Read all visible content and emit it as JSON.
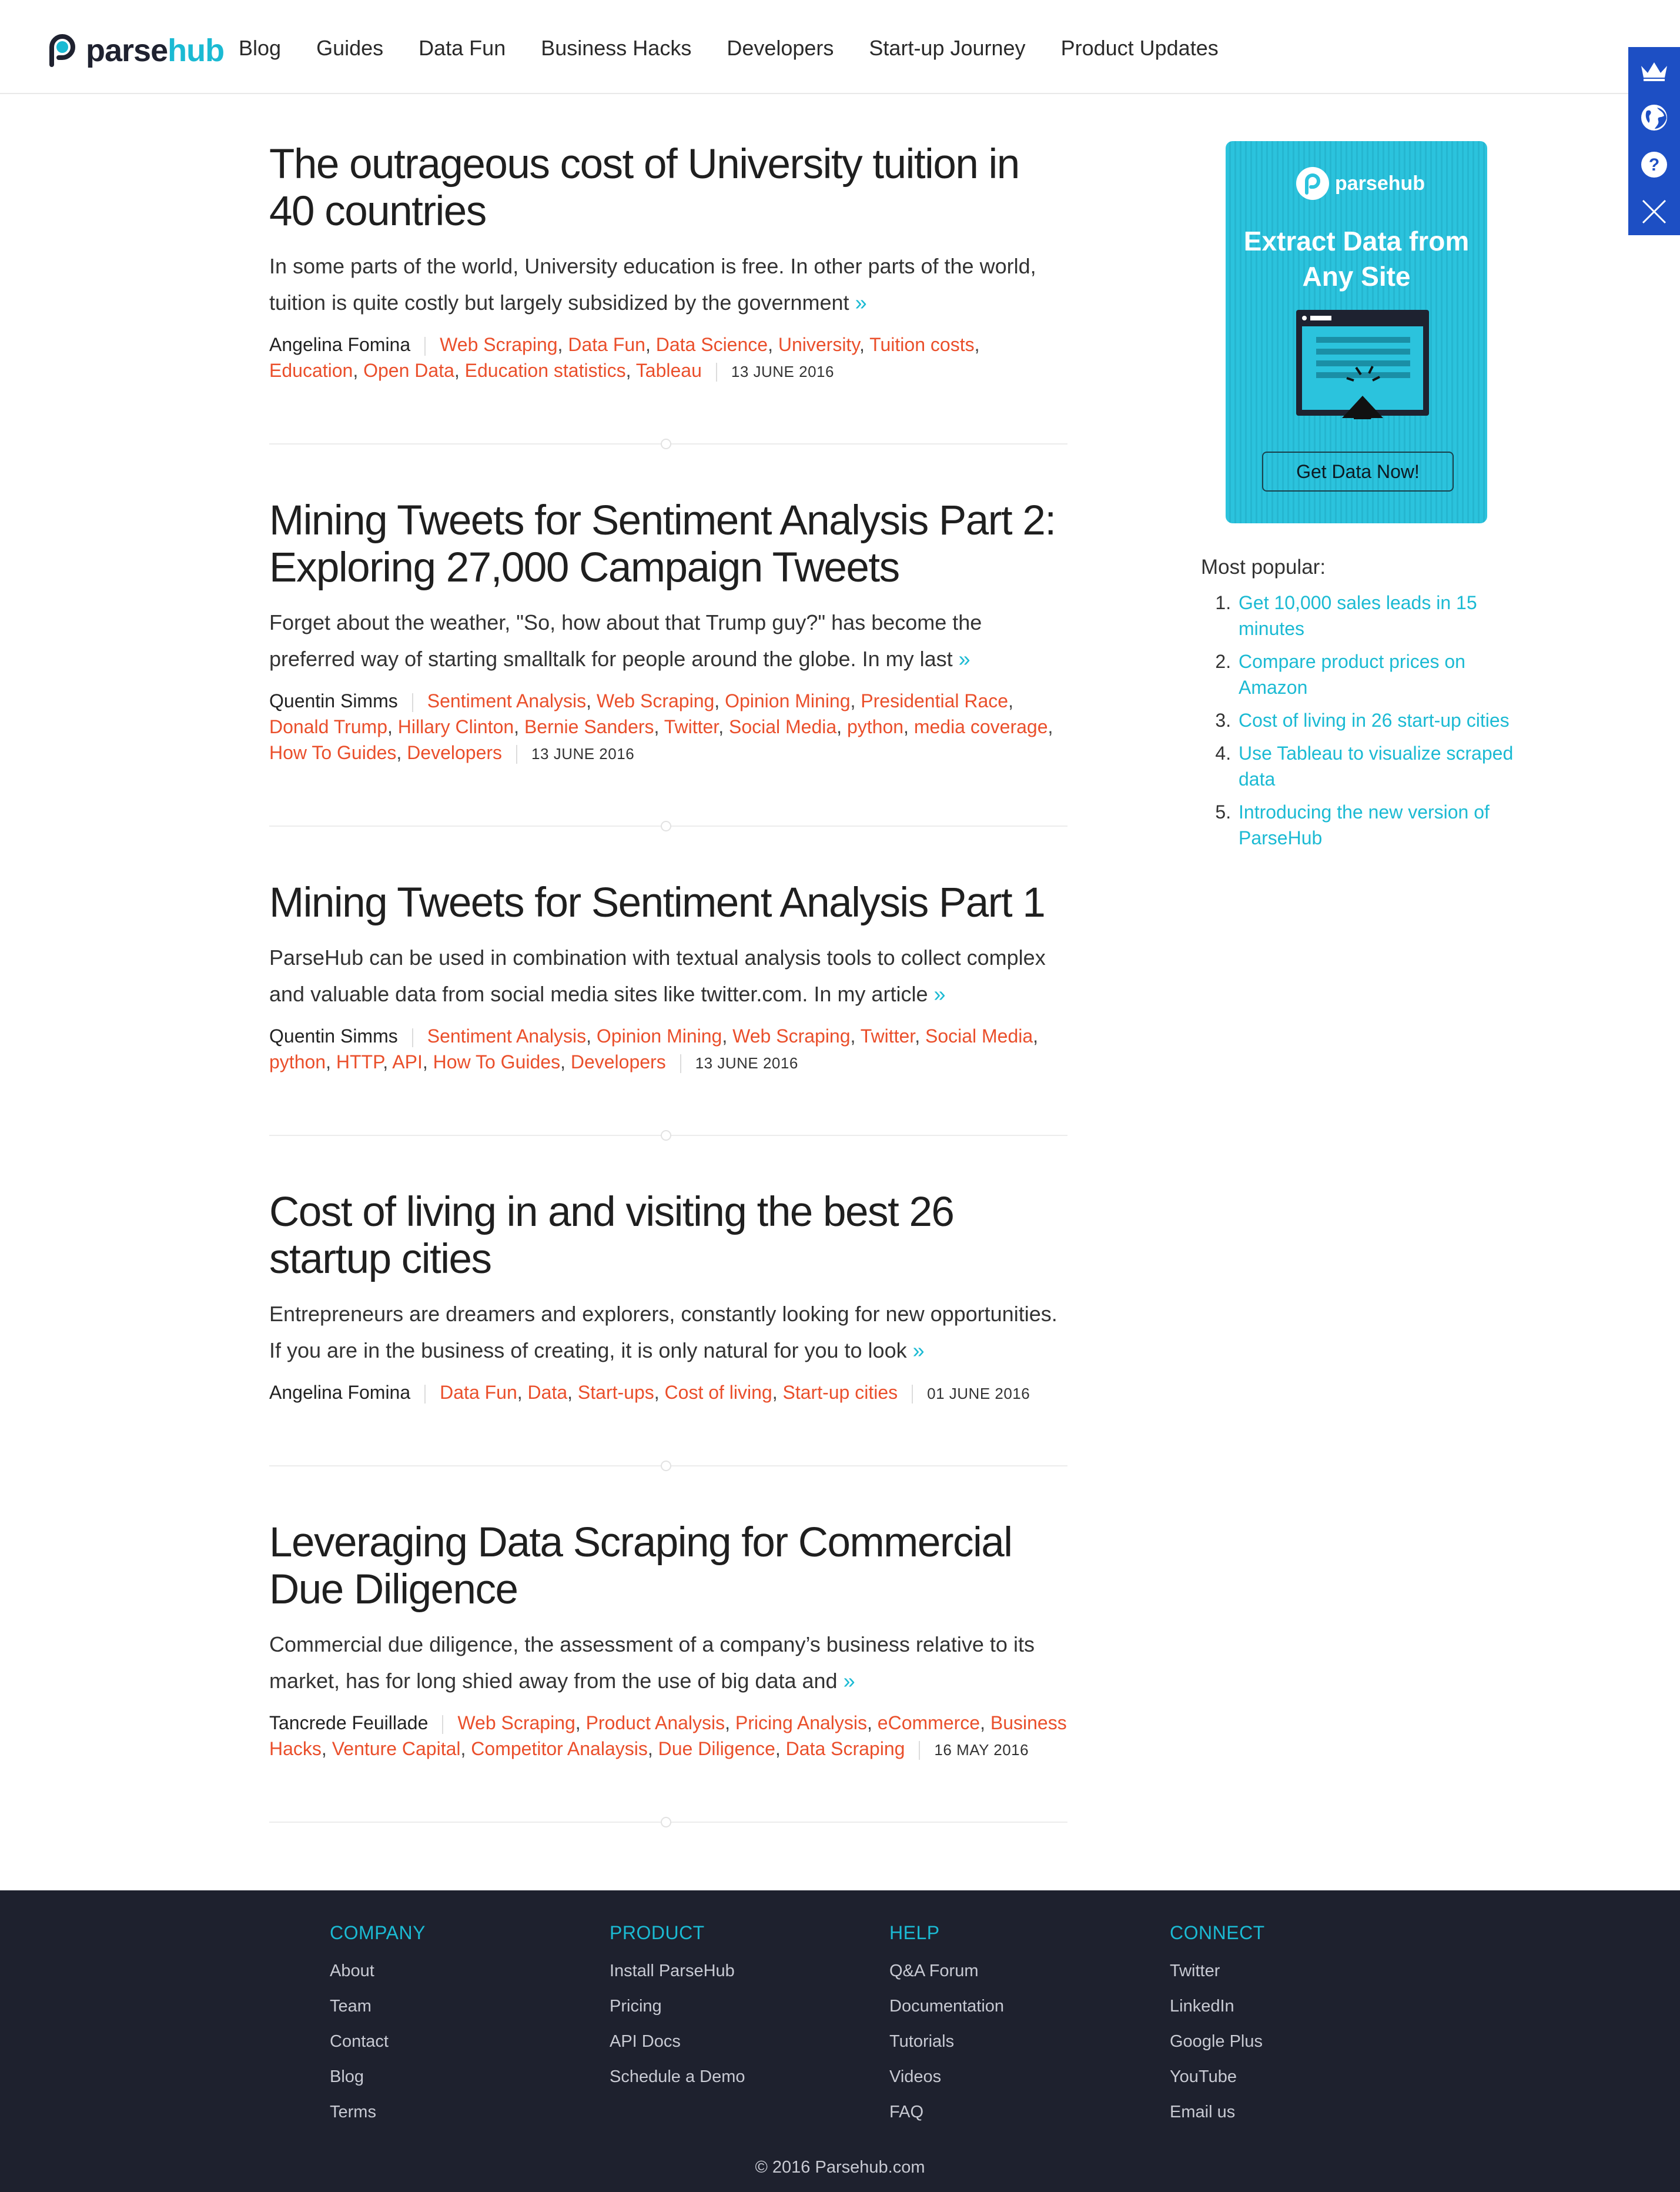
{
  "brand": {
    "name_part1": "parse",
    "name_part2": "hub",
    "accent": "#1bbad3",
    "tag_color": "#ea4f2b"
  },
  "nav": [
    "Blog",
    "Guides",
    "Data Fun",
    "Business Hacks",
    "Developers",
    "Start-up Journey",
    "Product Updates"
  ],
  "side_widget": {
    "icons": [
      "crown-icon",
      "globe-icon",
      "help-icon",
      "close-icon"
    ],
    "color": "#1d4fc4"
  },
  "articles": [
    {
      "title": "The outrageous cost of University tuition in 40 countries",
      "excerpt": "In some parts of the world, University education is free. In other parts of the world, tuition is quite costly but largely subsidized by the government",
      "more": "»",
      "author": "Angelina Fomina",
      "tags": [
        "Web Scraping",
        "Data Fun",
        "Data Science",
        "University",
        "Tuition costs",
        "Education",
        "Open Data",
        "Education statistics",
        "Tableau"
      ],
      "date": "13 JUNE 2016"
    },
    {
      "title": "Mining Tweets for Sentiment Analysis Part 2: Exploring 27,000 Campaign Tweets",
      "excerpt": "Forget about the weather, \"So, how about that Trump guy?\" has become the preferred way of starting smalltalk for people around the globe. In my last",
      "more": "»",
      "author": "Quentin Simms",
      "tags": [
        "Sentiment Analysis",
        "Web Scraping",
        "Opinion Mining",
        "Presidential Race",
        "Donald Trump",
        "Hillary Clinton",
        "Bernie Sanders",
        "Twitter",
        "Social Media",
        "python",
        "media coverage",
        "How To Guides",
        "Developers"
      ],
      "date": "13 JUNE 2016"
    },
    {
      "title": "Mining Tweets for Sentiment Analysis Part 1",
      "excerpt": "ParseHub can be used in combination with textual analysis tools to collect complex and valuable data from social media sites like twitter.com. In my article",
      "more": "»",
      "author": "Quentin Simms",
      "tags": [
        "Sentiment Analysis",
        "Opinion Mining",
        "Web Scraping",
        "Twitter",
        "Social Media",
        "python",
        "HTTP",
        "API",
        "How To Guides",
        "Developers"
      ],
      "date": "13 JUNE 2016"
    },
    {
      "title": "Cost of living in and visiting the best 26 startup cities",
      "excerpt": "Entrepreneurs are dreamers and explorers, constantly looking for new opportunities. If you are in the business of creating, it is only natural for you to look",
      "more": "»",
      "author": "Angelina Fomina",
      "tags": [
        "Data Fun",
        "Data",
        "Start-ups",
        "Cost of living",
        "Start-up cities"
      ],
      "date": "01 JUNE 2016"
    },
    {
      "title": "Leveraging Data Scraping for Commercial Due Diligence",
      "excerpt": "Commercial due diligence, the assessment of a company’s business relative to its market, has for long shied away from the use of big data and",
      "more": "»",
      "author": "Tancrede Feuillade",
      "tags": [
        "Web Scraping",
        "Product Analysis",
        "Pricing Analysis",
        "eCommerce",
        "Business Hacks",
        "Venture Capital",
        "Competitor Analaysis",
        "Due Diligence",
        "Data Scraping"
      ],
      "date": "16 MAY 2016"
    }
  ],
  "ad": {
    "logo_text": "parsehub",
    "headline_line1": "Extract Data from",
    "headline_line2": "Any Site",
    "button": "Get Data Now!"
  },
  "popular": {
    "title": "Most popular:",
    "items": [
      "Get 10,000 sales leads in 15 minutes",
      "Compare product prices on Amazon",
      "Cost of living in 26 start-up cities",
      "Use Tableau to visualize scraped data",
      "Introducing the new version of ParseHub"
    ]
  },
  "footer": {
    "columns": [
      {
        "heading": "COMPANY",
        "links": [
          "About",
          "Team",
          "Contact",
          "Blog",
          "Terms"
        ]
      },
      {
        "heading": "PRODUCT",
        "links": [
          "Install ParseHub",
          "Pricing",
          "API Docs",
          "Schedule a Demo"
        ]
      },
      {
        "heading": "HELP",
        "links": [
          "Q&A Forum",
          "Documentation",
          "Tutorials",
          "Videos",
          "FAQ"
        ]
      },
      {
        "heading": "CONNECT",
        "links": [
          "Twitter",
          "LinkedIn",
          "Google Plus",
          "YouTube",
          "Email us"
        ]
      }
    ],
    "copyright": "© 2016 Parsehub.com"
  }
}
